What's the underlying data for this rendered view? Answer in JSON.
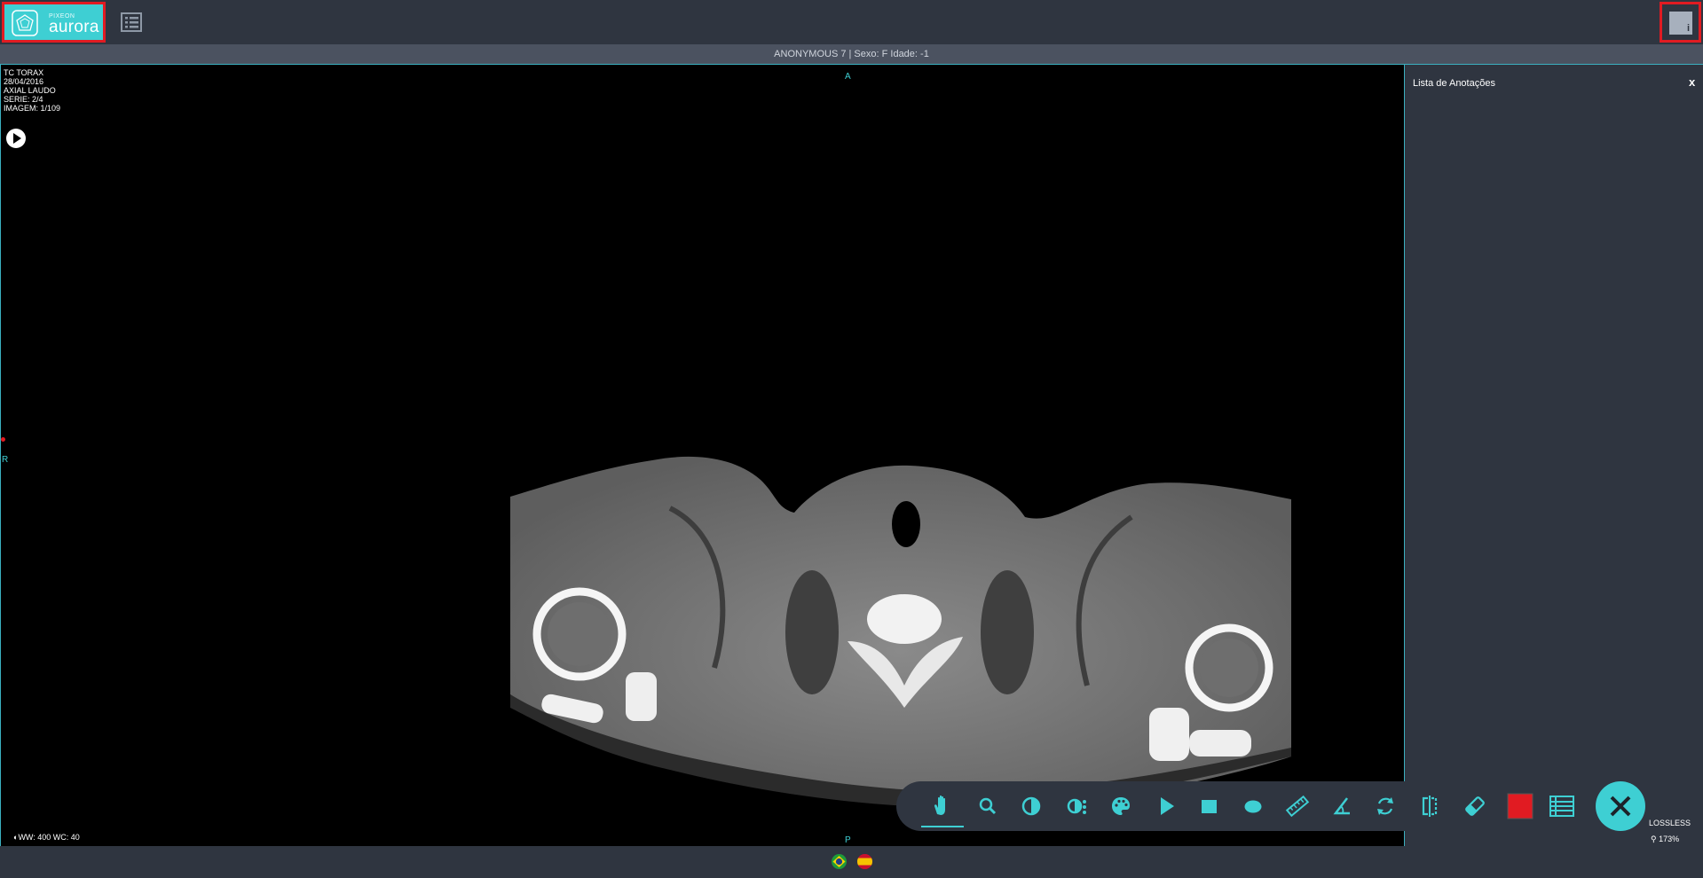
{
  "header": {
    "logo_small": "PIXEON",
    "logo_text": "aurora",
    "info_glyph": "i"
  },
  "patient": {
    "summary": "ANONYMOUS 7 |    Sexo: F    Idade: -1"
  },
  "viewer": {
    "study": "TC TORAX",
    "date": "28/04/2016",
    "series_desc": "AXIAL LAUDO",
    "series": "SERIE: 2/4",
    "image": "IMAGEM: 1/109",
    "orient_top": "A",
    "orient_left": "R",
    "orient_bottom": "P",
    "window": "WW: 400 WC: 40",
    "compression": "LOSSLESS",
    "zoom": "173%"
  },
  "annotations": {
    "title": "Lista de Anotações",
    "close": "x"
  },
  "toolbar": {
    "accent": "#3ecfd3",
    "tools": [
      "hand-icon",
      "zoom-icon",
      "contrast-icon",
      "window-presets-icon",
      "palette-icon",
      "play-icon",
      "rectangle-icon",
      "ellipse-icon",
      "ruler-icon",
      "angle-icon",
      "rotate-icon",
      "flip-icon",
      "eraser-icon",
      "color-swatch",
      "list-icon"
    ],
    "active_tool": "hand-icon"
  },
  "locale": {
    "flags": [
      "brazil-flag-icon",
      "spain-flag-icon"
    ]
  }
}
